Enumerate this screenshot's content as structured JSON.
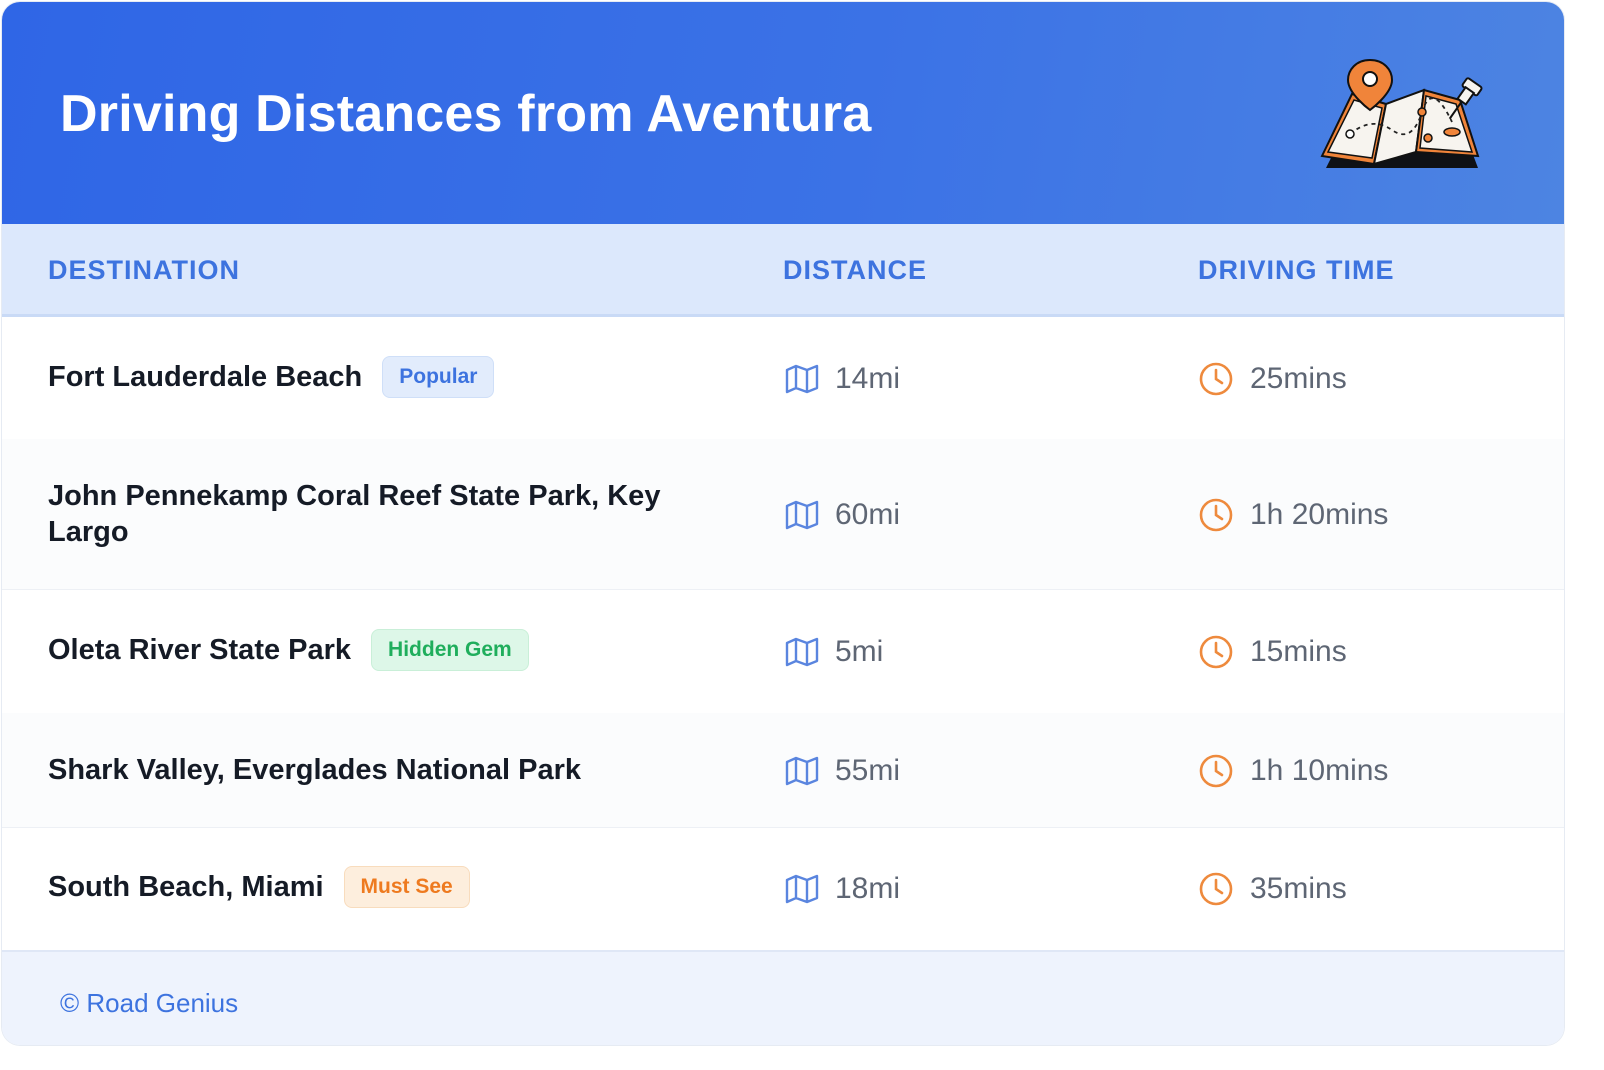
{
  "header": {
    "title": "Driving Distances from Aventura",
    "illustration_icon": "map-with-pin-icon",
    "gradient_start": "#2f66e6",
    "gradient_end": "#4d84e2"
  },
  "table": {
    "columns": [
      "DESTINATION",
      "DISTANCE",
      "DRIVING TIME"
    ],
    "distance_icon": "map-icon",
    "time_icon": "clock-icon",
    "rows": [
      {
        "destination": "Fort Lauderdale Beach",
        "badge": "Popular",
        "badge_color": "#3d73df",
        "distance": "14mi",
        "time": "25mins"
      },
      {
        "destination": "John Pennekamp Coral Reef State Park, Key Largo",
        "badge": "",
        "badge_color": "",
        "distance": "60mi",
        "time": "1h 20mins"
      },
      {
        "destination": "Oleta River State Park",
        "badge": "Hidden Gem",
        "badge_color": "#1fae5c",
        "distance": "5mi",
        "time": "15mins"
      },
      {
        "destination": "Shark Valley, Everglades National Park",
        "badge": "",
        "badge_color": "",
        "distance": "55mi",
        "time": "1h 10mins"
      },
      {
        "destination": "South Beach, Miami",
        "badge": "Must See",
        "badge_color": "#ee7a1f",
        "distance": "18mi",
        "time": "35mins"
      }
    ]
  },
  "footer": {
    "copyright": "© Road Genius"
  },
  "colors": {
    "accent_blue": "#3d73df",
    "clock_orange": "#ee8a3d",
    "map_icon_blue": "#5a85df"
  }
}
